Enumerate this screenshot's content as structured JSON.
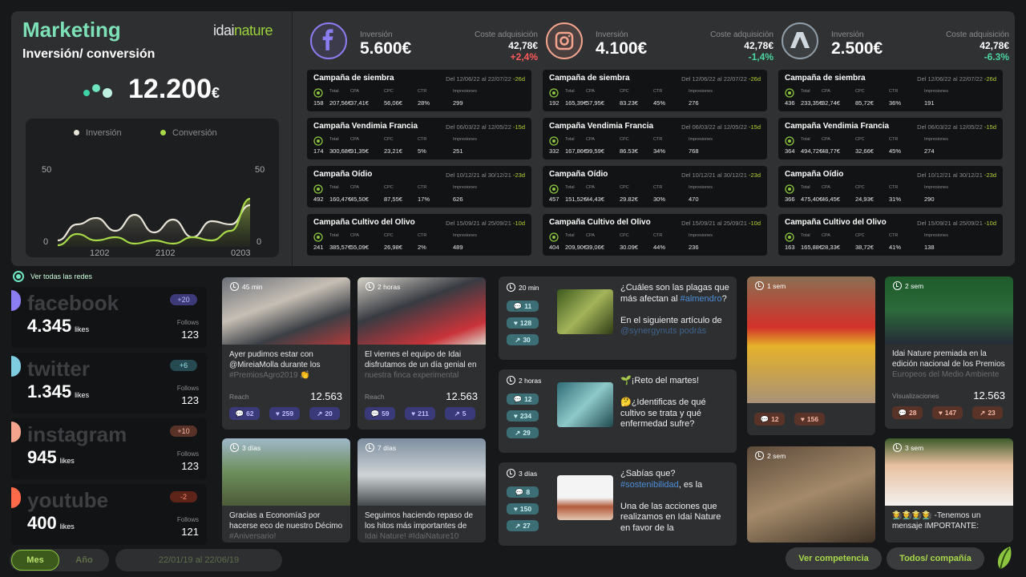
{
  "header": {
    "title": "Marketing",
    "subtitle": "Inversión/ conversión",
    "brand_a": "idai",
    "brand_b": "nature",
    "total": "12.200",
    "total_unit": "€"
  },
  "chart": {
    "legend_a": "Inversión",
    "legend_b": "Conversión",
    "y_left": [
      "50",
      "0"
    ],
    "y_right": [
      "50",
      "0"
    ],
    "x_ticks": [
      "1202",
      "2102",
      "0203"
    ],
    "colors": {
      "inversion": "#e8e4d8",
      "conversion": "#a7d948"
    }
  },
  "chart_data": {
    "type": "area",
    "categories": [
      "1202",
      "",
      "",
      "",
      "",
      "2102",
      "",
      "",
      "",
      "",
      "0203"
    ],
    "series": [
      {
        "name": "Inversión",
        "values": [
          4,
          14,
          18,
          10,
          20,
          9,
          17,
          6,
          16,
          14,
          26
        ]
      },
      {
        "name": "Conversión",
        "values": [
          1,
          8,
          4,
          6,
          2,
          4,
          2,
          6,
          4,
          10,
          30
        ]
      }
    ],
    "ylim": [
      0,
      50
    ]
  },
  "networks": [
    {
      "name": "facebook",
      "inv_label": "Inversión",
      "inv": "5.600€",
      "cost_label": "Coste adquisición",
      "cost": "42,78€",
      "delta": "+2,4%",
      "delta_color": "#ff5a5a",
      "color": "#8b7df2",
      "campaigns": [
        {
          "name": "Campaña de siembra",
          "date": "Del 12/06/22 al 22/07/22",
          "days": "-26d",
          "v": [
            "158",
            "207,56€",
            "37,41€",
            "56,06€",
            "28%",
            "299"
          ]
        },
        {
          "name": "Campaña Vendimia Francia",
          "date": "Del 06/03/22 al 12/05/22",
          "days": "-15d",
          "v": [
            "174",
            "300,68€",
            "91,35€",
            "23,21€",
            "5%",
            "251"
          ]
        },
        {
          "name": "Campaña Oídio",
          "date": "Del 10/12/21 al 30/12/21",
          "days": "-23d",
          "v": [
            "492",
            "160,47€",
            "45,50€",
            "87,55€",
            "17%",
            "626"
          ]
        },
        {
          "name": "Campaña Cultivo del Olivo",
          "date": "Del 15/09/21 al 25/09/21",
          "days": "-10d",
          "v": [
            "241",
            "385,57€",
            "55,09€",
            "26,98€",
            "2%",
            "489"
          ]
        }
      ]
    },
    {
      "name": "instagram",
      "inv_label": "Inversión",
      "inv": "4.100€",
      "cost_label": "Coste adquisición",
      "cost": "42,78€",
      "delta": "-1,4%",
      "delta_color": "#4ad6a0",
      "color": "#f4a38c",
      "campaigns": [
        {
          "name": "Campaña de siembra",
          "date": "Del 12/06/22 al 22/07/22",
          "days": "-26d",
          "v": [
            "192",
            "165,39€",
            "57,95€",
            "83.23€",
            "45%",
            "276"
          ]
        },
        {
          "name": "Campaña Vendimia Francia",
          "date": "Del 06/03/22 al 12/05/22",
          "days": "-15d",
          "v": [
            "332",
            "167,86€",
            "99,59€",
            "86.53€",
            "34%",
            "768"
          ]
        },
        {
          "name": "Campaña Oídio",
          "date": "Del 10/12/21 al 30/12/21",
          "days": "-23d",
          "v": [
            "457",
            "151,52€",
            "44,43€",
            "29.82€",
            "30%",
            "470"
          ]
        },
        {
          "name": "Campaña Cultivo del Olivo",
          "date": "Del 15/09/21 al 25/09/21",
          "days": "-10d",
          "v": [
            "404",
            "209,90€",
            "39,06€",
            "30.09€",
            "44%",
            "236"
          ]
        }
      ]
    },
    {
      "name": "ads",
      "inv_label": "Inversión",
      "inv": "2.500€",
      "cost_label": "Coste adquisición",
      "cost": "42,78€",
      "delta": "-6.3%",
      "delta_color": "#4ad6a0",
      "color": "#8f9ea8",
      "campaigns": [
        {
          "name": "Campaña de siembra",
          "date": "Del 12/06/22 al 22/07/22",
          "days": "-26d",
          "v": [
            "436",
            "233,35€",
            "82,74€",
            "85,72€",
            "36%",
            "191"
          ]
        },
        {
          "name": "Campaña Vendimia Francia",
          "date": "Del 06/03/22 al 12/05/22",
          "days": "-15d",
          "v": [
            "364",
            "494,72€",
            "48,77€",
            "32,66€",
            "45%",
            "274"
          ]
        },
        {
          "name": "Campaña Oídio",
          "date": "Del 10/12/21 al 30/12/21",
          "days": "-23d",
          "v": [
            "366",
            "475,40€",
            "46,45€",
            "24,93€",
            "31%",
            "290"
          ]
        },
        {
          "name": "Campaña Cultivo del Olivo",
          "date": "Del 15/09/21 al 25/09/21",
          "days": "-10d",
          "v": [
            "163",
            "165,88€",
            "28,33€",
            "38,72€",
            "41%",
            "138"
          ]
        }
      ]
    }
  ],
  "col_labels": [
    "Total",
    "CPA",
    "CPC",
    "CTR",
    "Impresiones"
  ],
  "social": {
    "see_all": "Ver todas las redes",
    "followers_label": "Follows",
    "items": [
      {
        "name": "facebook",
        "likes": "4.345",
        "likes_label": "likes",
        "badge": "+20",
        "followers": "123",
        "color": "#8b7df2",
        "badge_bg": "#3d3a7a",
        "badge_fg": "#c2bafc"
      },
      {
        "name": "twitter",
        "likes": "1.345",
        "likes_label": "likes",
        "badge": "+6",
        "followers": "123",
        "color": "#7fcbe0",
        "badge_bg": "#254a52",
        "badge_fg": "#9de2f0"
      },
      {
        "name": "instagram",
        "likes": "945",
        "likes_label": "likes",
        "badge": "+10",
        "followers": "123",
        "color": "#f4a38c",
        "badge_bg": "#5a3328",
        "badge_fg": "#f6b7a4"
      },
      {
        "name": "youtube",
        "likes": "400",
        "likes_label": "likes",
        "badge": "-2",
        "followers": "121",
        "color": "#ff6a4a",
        "badge_bg": "#5f2419",
        "badge_fg": "#ff8d72"
      }
    ]
  },
  "fb_posts": [
    {
      "time": "45 min",
      "text": "Ayer pudimos estar con @MireiaMolla durante los ",
      "fade": "#PremiosAgro2019 👏",
      "reach_label": "Reach",
      "reach": "12.563",
      "p": [
        "62",
        "259",
        "20"
      ]
    },
    {
      "time": "2 horas",
      "text": "El viernes el equipo de Idai disfrutamos de un día genial en ",
      "fade": "nuestra finca experimental",
      "reach_label": "Reach",
      "reach": "12.563",
      "p": [
        "59",
        "211",
        "5"
      ]
    },
    {
      "time": "3 días",
      "text": "Gracias a Economía3 por hacerse eco de nuestro Décimo ",
      "fade": "#Aniversario!"
    },
    {
      "time": "7 días",
      "text": "Seguimos haciendo repaso de los hitos más importantes de ",
      "fade": "Idai Nature! #IdaiNature10"
    }
  ],
  "tw_posts": [
    {
      "time": "20 min",
      "p": [
        "11",
        "128",
        "30"
      ],
      "text": "¿Cuáles son las plagas que más afectan al ",
      "link": "#almendro",
      "text2": "?",
      "text3": "En el siguiente artículo de ",
      "fade": "@synergynuts podrás"
    },
    {
      "time": "2 horas",
      "p": [
        "12",
        "234",
        "29"
      ],
      "text": "🌱¡Reto del martes!",
      "text3": "🤔¿Identificas de qué cultivo se trata y qué enfermedad sufre?"
    },
    {
      "time": "3 días",
      "p": [
        "8",
        "150",
        "27"
      ],
      "text": "¿Sabías que?",
      "text3": "Una de las acciones que realizamos en Idai Nature en favor de la ",
      "link": "#sostenibilidad",
      "text4": ", es la"
    }
  ],
  "ig_posts": [
    {
      "time": "1 sem",
      "p": [
        "12",
        "156"
      ]
    },
    {
      "time": "2 sem",
      "text": "Idai Nature premiada en la edición nacional de los Premios ",
      "fade": "Europeos del Medio Ambiente",
      "reach_label": "Visualizaciones",
      "reach": "12.563",
      "p": [
        "28",
        "147",
        "23"
      ]
    },
    {
      "time": "2 sem"
    },
    {
      "time": "3 sem",
      "text": "👩‍🌾👨‍🌾👩‍🌾👨‍🌾 -Tenemos un mensaje IMPORTANTE:"
    }
  ],
  "footer": {
    "month": "Mes",
    "year": "Año",
    "range": "22/01/19 al 22/06/19",
    "competition": "Ver  competencia",
    "all": "Todos/ compañía"
  }
}
